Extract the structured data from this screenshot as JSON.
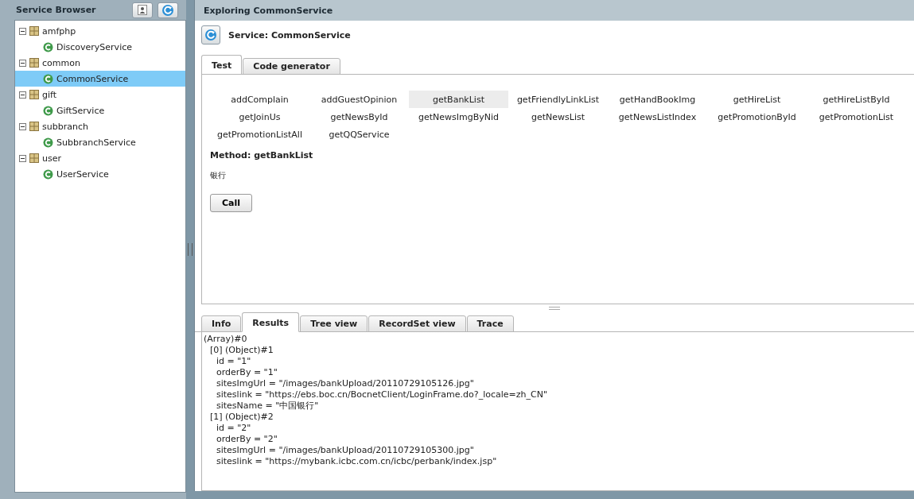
{
  "sidebar": {
    "title": "Service Browser",
    "tree": [
      {
        "label": "amfphp",
        "expanded": true,
        "children": [
          {
            "label": "DiscoveryService",
            "selected": false
          }
        ]
      },
      {
        "label": "common",
        "expanded": true,
        "children": [
          {
            "label": "CommonService",
            "selected": true
          }
        ]
      },
      {
        "label": "gift",
        "expanded": true,
        "children": [
          {
            "label": "GiftService",
            "selected": false
          }
        ]
      },
      {
        "label": "subbranch",
        "expanded": true,
        "children": [
          {
            "label": "SubbranchService",
            "selected": false
          }
        ]
      },
      {
        "label": "user",
        "expanded": true,
        "children": [
          {
            "label": "UserService",
            "selected": false
          }
        ]
      }
    ]
  },
  "main": {
    "title": "Exploring CommonService",
    "service": "Service: CommonService",
    "tabs": [
      {
        "label": "Test",
        "selected": true
      },
      {
        "label": "Code generator",
        "selected": false
      }
    ],
    "methods": [
      {
        "label": "addComplain",
        "selected": false
      },
      {
        "label": "addGuestOpinion",
        "selected": false
      },
      {
        "label": "getBankList",
        "selected": true
      },
      {
        "label": "getFriendlyLinkList",
        "selected": false
      },
      {
        "label": "getHandBookImg",
        "selected": false
      },
      {
        "label": "getHireList",
        "selected": false
      },
      {
        "label": "getHireListById",
        "selected": false
      },
      {
        "label": "getJoinUs",
        "selected": false
      },
      {
        "label": "getNewsById",
        "selected": false
      },
      {
        "label": "getNewsImgByNid",
        "selected": false
      },
      {
        "label": "getNewsList",
        "selected": false
      },
      {
        "label": "getNewsListIndex",
        "selected": false
      },
      {
        "label": "getPromotionById",
        "selected": false
      },
      {
        "label": "getPromotionList",
        "selected": false
      },
      {
        "label": "getPromotionListAll",
        "selected": false
      },
      {
        "label": "getQQService",
        "selected": false
      }
    ],
    "method_title": "Method: getBankList",
    "method_description": "银行",
    "call_button": "Call"
  },
  "results": {
    "tabs": [
      {
        "label": "Info",
        "selected": false
      },
      {
        "label": "Results",
        "selected": true
      },
      {
        "label": "Tree view",
        "selected": false
      },
      {
        "label": "RecordSet view",
        "selected": false
      },
      {
        "label": "Trace",
        "selected": false
      }
    ],
    "lines": [
      {
        "text": "(Array)#0",
        "children": [
          {
            "text": "[0] (Object)#1",
            "children": [
              {
                "text": "id = \"1\""
              },
              {
                "text": "orderBy = \"1\""
              },
              {
                "text": "sitesImgUrl = \"/images/bankUpload/20110729105126.jpg\""
              },
              {
                "text": "siteslink = \"https://ebs.boc.cn/BocnetClient/LoginFrame.do?_locale=zh_CN\""
              },
              {
                "text": "sitesName = \"中国银行\""
              }
            ]
          },
          {
            "text": "[1] (Object)#2",
            "children": [
              {
                "text": "id = \"2\""
              },
              {
                "text": "orderBy = \"2\""
              },
              {
                "text": "sitesImgUrl = \"/images/bankUpload/20110729105300.jpg\""
              },
              {
                "text": "siteslink = \"https://mybank.icbc.com.cn/icbc/perbank/index.jsp\""
              }
            ]
          }
        ]
      }
    ]
  }
}
